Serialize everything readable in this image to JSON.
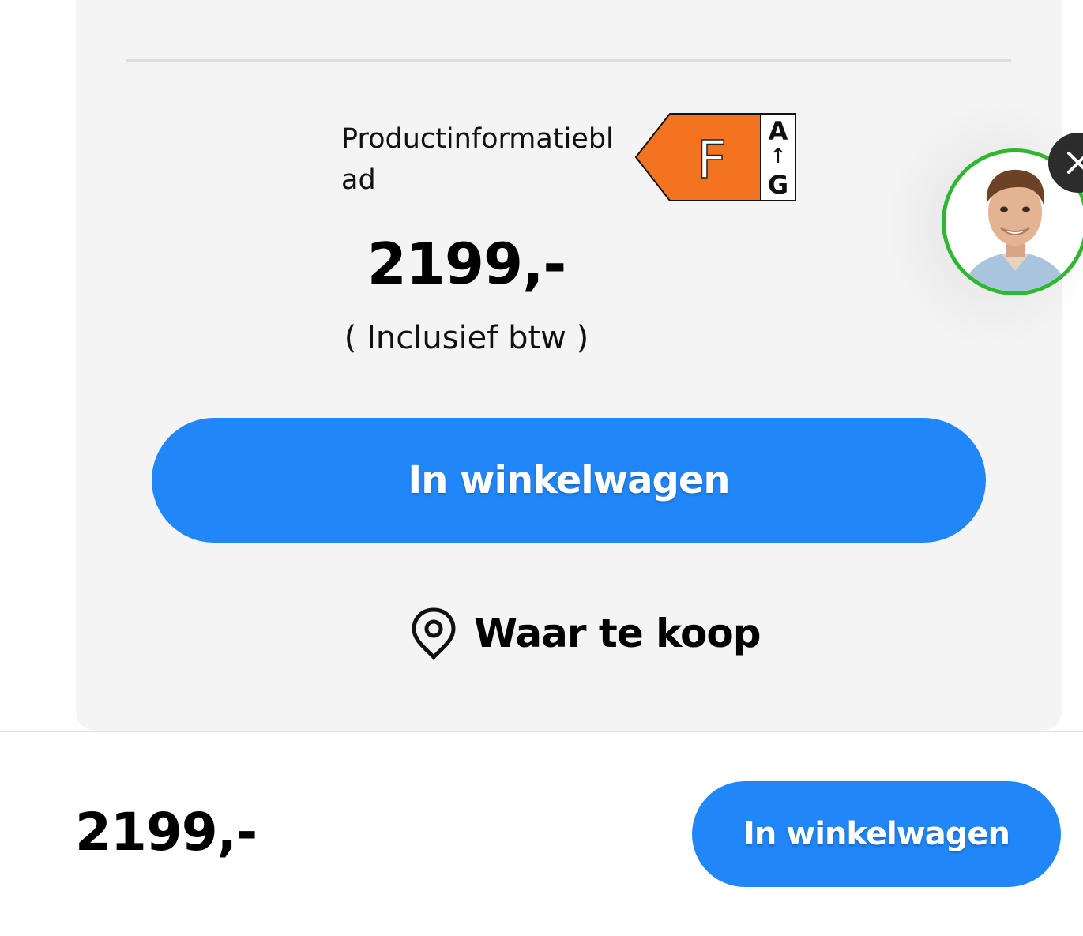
{
  "product": {
    "info_link": "Productinformatieblad",
    "energy_label": {
      "class": "F",
      "scale_top": "A",
      "scale_arrow": "↑",
      "scale_bottom": "G",
      "color": "#f47321"
    },
    "price": "2199,-",
    "vat_note": "( Inclusief btw )",
    "add_to_cart_label": "In winkelwagen",
    "where_to_buy_label": "Waar te koop"
  },
  "sticky_bar": {
    "price": "2199,-",
    "add_to_cart_label": "In winkelwagen"
  },
  "chat": {
    "avatar_icon": "agent-avatar",
    "close_icon": "close-icon",
    "avatar_ring_color": "#2fb82f"
  },
  "colors": {
    "primary_button": "#2187f9",
    "card_background": "#f4f4f4"
  }
}
